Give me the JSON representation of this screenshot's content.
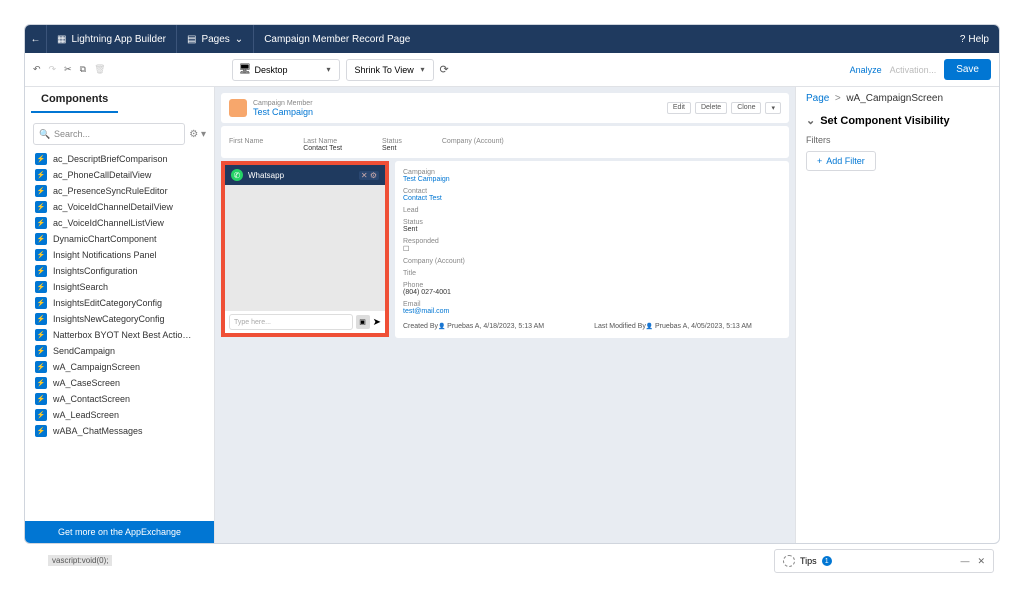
{
  "topbar": {
    "app_label": "Lightning App Builder",
    "pages_label": "Pages",
    "record_title": "Campaign Member Record Page",
    "help": "Help"
  },
  "toolbar": {
    "device": "Desktop",
    "view": "Shrink To View",
    "analyze": "Analyze",
    "activation": "Activation...",
    "save": "Save"
  },
  "sidebar": {
    "header": "Components",
    "search_placeholder": "Search...",
    "items": [
      "ac_DescriptBriefComparison",
      "ac_PhoneCallDetailView",
      "ac_PresenceSyncRuleEditor",
      "ac_VoiceIdChannelDetailView",
      "ac_VoiceIdChannelListView",
      "DynamicChartComponent",
      "Insight Notifications Panel",
      "InsightsConfiguration",
      "InsightSearch",
      "InsightsEditCategoryConfig",
      "InsightsNewCategoryConfig",
      "Natterbox BYOT Next Best Actio…",
      "SendCampaign",
      "wA_CampaignScreen",
      "wA_CaseScreen",
      "wA_ContactScreen",
      "wA_LeadScreen",
      "wABA_ChatMessages"
    ],
    "appexchange": "Get more on the AppExchange"
  },
  "record": {
    "sub": "Campaign Member",
    "title": "Test Campaign",
    "buttons": [
      "Edit",
      "Delete",
      "Clone"
    ],
    "fields": [
      {
        "lbl": "First Name",
        "val": ""
      },
      {
        "lbl": "Last Name",
        "val": "Contact Test"
      },
      {
        "lbl": "Status",
        "val": "Sent"
      },
      {
        "lbl": "Company (Account)",
        "val": ""
      }
    ]
  },
  "whatsapp": {
    "title": "Whatsapp",
    "placeholder": "Type here..."
  },
  "detail": {
    "campaign_lbl": "Campaign",
    "campaign": "Test Campaign",
    "contact_lbl": "Contact",
    "contact": "Contact Test",
    "lead_lbl": "Lead",
    "status_lbl": "Status",
    "status": "Sent",
    "responded_lbl": "Responded",
    "company_lbl": "Company (Account)",
    "title_lbl": "Title",
    "phone_lbl": "Phone",
    "phone": "(804) 027-4001",
    "email_lbl": "Email",
    "email": "test@mail.com",
    "created_lbl": "Created By",
    "created": "Pruebas A, 4/18/2023, 5:13 AM",
    "modified_lbl": "Last Modified By",
    "modified": "Pruebas A, 4/05/2023, 5:13 AM"
  },
  "rightpanel": {
    "crumb_root": "Page",
    "crumb_current": "wA_CampaignScreen",
    "section": "Set Component Visibility",
    "filters_label": "Filters",
    "add_filter": "Add Filter"
  },
  "tips": {
    "label": "Tips",
    "count": "1"
  },
  "status_bar": "vascript:void(0);"
}
